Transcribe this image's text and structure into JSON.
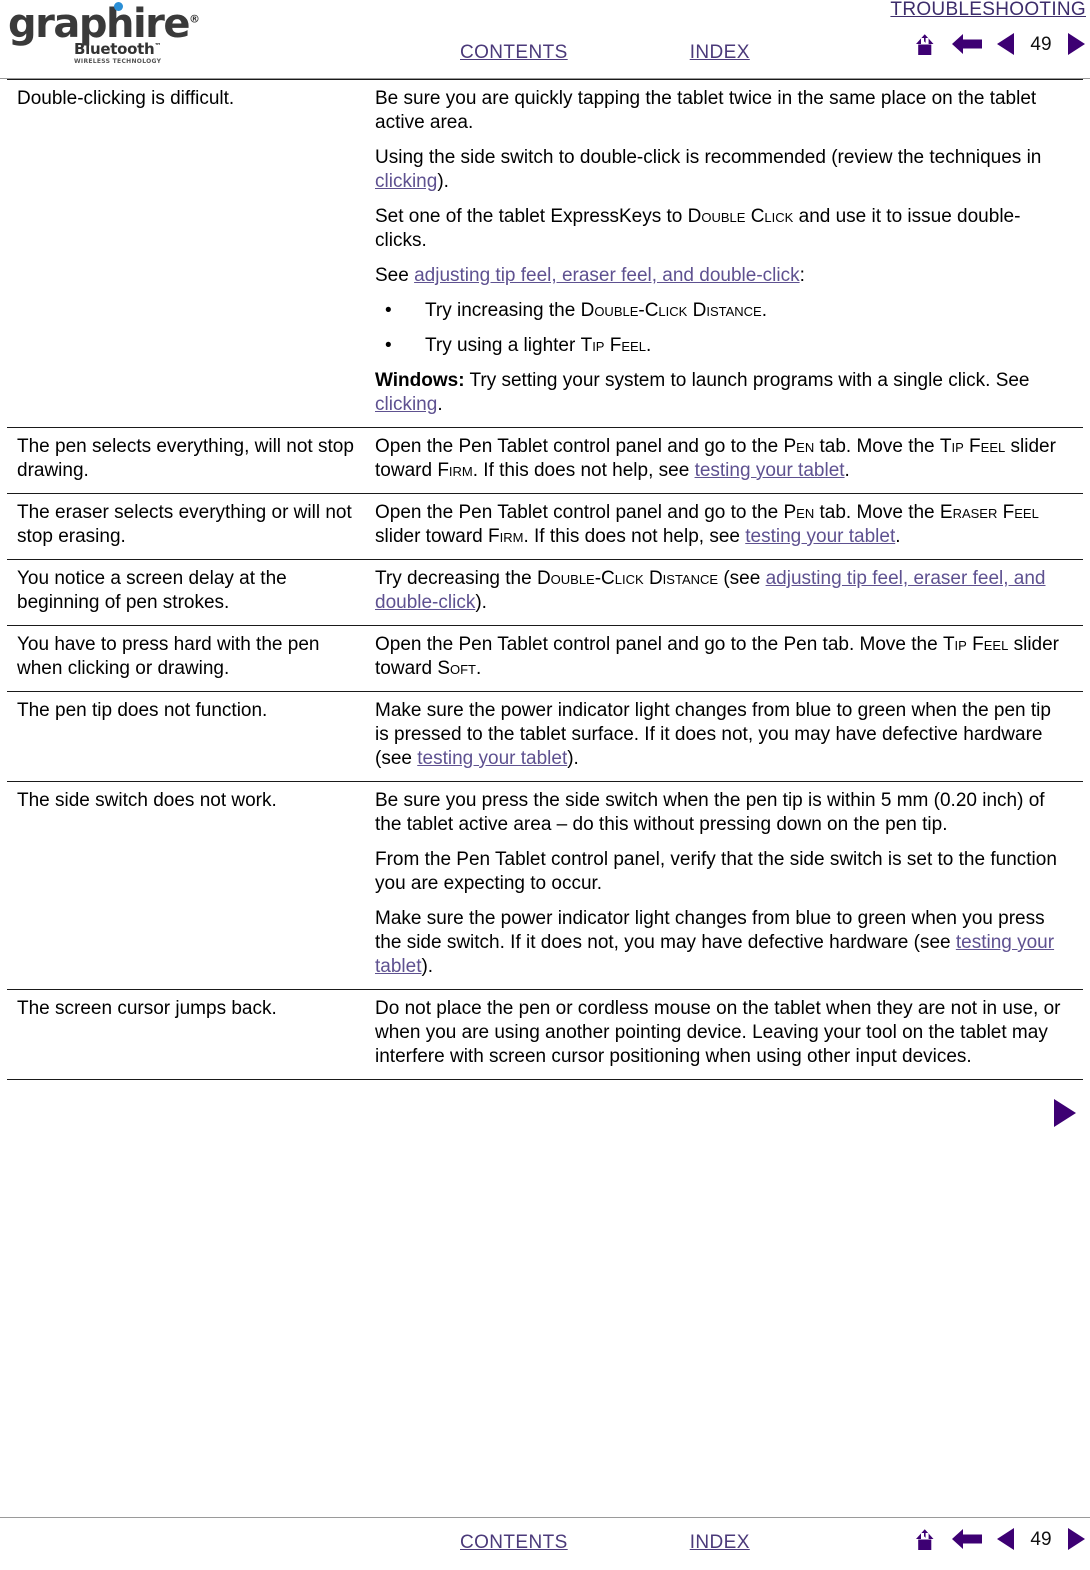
{
  "brand": {
    "name": "graphire",
    "registered": "®",
    "bluetooth": "Bluetooth",
    "bluetooth_tm": "™",
    "tagline": "WIRELESS TECHNOLOGY",
    "dot_color": "#2b8fd6"
  },
  "header": {
    "section_title": "TROUBLESHOOTING",
    "contents_label": "CONTENTS",
    "index_label": "INDEX",
    "page_number": "49",
    "nav_icons": [
      "home-icon",
      "back-arrow-icon",
      "previous-page-icon",
      "next-page-icon"
    ],
    "accent_color": "#3d0073",
    "link_color": "#5e5190"
  },
  "footer": {
    "contents_label": "CONTENTS",
    "index_label": "INDEX",
    "page_number": "49"
  },
  "content": {
    "next_arrow": "next-page-icon",
    "rows": [
      {
        "problem": "Double-clicking is difficult.",
        "solution": [
          {
            "type": "para",
            "runs": [
              {
                "t": "Be sure you are quickly tapping the tablet twice in the same place on the tablet active area.",
                "s": "plain"
              }
            ]
          },
          {
            "type": "para",
            "runs": [
              {
                "t": "Using the side switch to double-click is recommended (review the techniques in ",
                "s": "plain"
              },
              {
                "t": "clicking",
                "s": "link"
              },
              {
                "t": ").",
                "s": "plain"
              }
            ]
          },
          {
            "type": "para",
            "runs": [
              {
                "t": "Set one of the tablet ExpressKeys to ",
                "s": "plain"
              },
              {
                "t": "Double Click",
                "s": "smallcaps"
              },
              {
                "t": " and use it to issue double-clicks.",
                "s": "plain"
              }
            ]
          },
          {
            "type": "para",
            "runs": [
              {
                "t": "See ",
                "s": "plain"
              },
              {
                "t": "adjusting tip feel, eraser feel, and double-click",
                "s": "link"
              },
              {
                "t": ":",
                "s": "plain"
              }
            ]
          },
          {
            "type": "bullet",
            "runs": [
              {
                "t": "Try increasing the ",
                "s": "plain"
              },
              {
                "t": "Double-Click Distance",
                "s": "smallcaps"
              },
              {
                "t": ".",
                "s": "plain"
              }
            ]
          },
          {
            "type": "bullet",
            "runs": [
              {
                "t": "Try using a lighter ",
                "s": "plain"
              },
              {
                "t": "Tip Feel",
                "s": "smallcaps"
              },
              {
                "t": ".",
                "s": "plain"
              }
            ]
          },
          {
            "type": "para",
            "runs": [
              {
                "t": "Windows:",
                "s": "bold"
              },
              {
                "t": " Try setting your system to launch programs with a single click.  See ",
                "s": "plain"
              },
              {
                "t": "clicking",
                "s": "link"
              },
              {
                "t": ".",
                "s": "plain"
              }
            ]
          }
        ]
      },
      {
        "problem": "The pen selects everything, will not stop drawing.",
        "solution": [
          {
            "type": "para",
            "runs": [
              {
                "t": "Open the Pen Tablet control panel and go to the ",
                "s": "plain"
              },
              {
                "t": "Pen",
                "s": "smallcaps"
              },
              {
                "t": " tab.  Move the ",
                "s": "plain"
              },
              {
                "t": "Tip Feel",
                "s": "smallcaps"
              },
              {
                "t": " slider toward ",
                "s": "plain"
              },
              {
                "t": "Firm",
                "s": "smallcaps"
              },
              {
                "t": ".  If this does not help, see ",
                "s": "plain"
              },
              {
                "t": "testing your tablet",
                "s": "link"
              },
              {
                "t": ".",
                "s": "plain"
              }
            ]
          }
        ]
      },
      {
        "problem": "The eraser selects everything or will not stop erasing.",
        "solution": [
          {
            "type": "para",
            "runs": [
              {
                "t": "Open the Pen Tablet control panel and go to the ",
                "s": "plain"
              },
              {
                "t": "Pen",
                "s": "smallcaps"
              },
              {
                "t": " tab.  Move the ",
                "s": "plain"
              },
              {
                "t": "Eraser Feel",
                "s": "smallcaps"
              },
              {
                "t": " slider toward ",
                "s": "plain"
              },
              {
                "t": "Firm",
                "s": "smallcaps"
              },
              {
                "t": ".  If this does not help, see ",
                "s": "plain"
              },
              {
                "t": "testing your tablet",
                "s": "link"
              },
              {
                "t": ".",
                "s": "plain"
              }
            ]
          }
        ]
      },
      {
        "problem": "You notice a screen delay at the beginning of pen strokes.",
        "solution": [
          {
            "type": "para",
            "runs": [
              {
                "t": "Try decreasing the ",
                "s": "plain"
              },
              {
                "t": "Double-Click Distance",
                "s": "smallcaps"
              },
              {
                "t": " (see ",
                "s": "plain"
              },
              {
                "t": "adjusting tip feel, eraser feel, and double-click",
                "s": "link"
              },
              {
                "t": ").",
                "s": "plain"
              }
            ]
          }
        ]
      },
      {
        "problem": "You have to press hard with the pen when clicking or drawing.",
        "solution": [
          {
            "type": "para",
            "runs": [
              {
                "t": "Open the Pen Tablet control panel and go to the Pen tab.  Move the ",
                "s": "plain"
              },
              {
                "t": "Tip Feel",
                "s": "smallcaps"
              },
              {
                "t": " slider toward ",
                "s": "plain"
              },
              {
                "t": "Soft",
                "s": "smallcaps"
              },
              {
                "t": ".",
                "s": "plain"
              }
            ]
          }
        ]
      },
      {
        "problem": "The pen tip does not function.",
        "solution": [
          {
            "type": "para",
            "runs": [
              {
                "t": "Make sure the power indicator light changes from blue to green when the pen tip is pressed to the tablet surface.  If it does not, you may have defective hardware (see ",
                "s": "plain"
              },
              {
                "t": "testing your tablet",
                "s": "link"
              },
              {
                "t": ").",
                "s": "plain"
              }
            ]
          }
        ]
      },
      {
        "problem": "The side switch does not work.",
        "solution": [
          {
            "type": "para",
            "runs": [
              {
                "t": "Be sure you press the side switch when the pen tip is within 5 mm (0.20 inch) of the tablet active area – do this without pressing down on the pen tip.",
                "s": "plain"
              }
            ]
          },
          {
            "type": "para",
            "runs": [
              {
                "t": "From the Pen Tablet control panel, verify that the side switch is set to the function you are expecting to occur.",
                "s": "plain"
              }
            ]
          },
          {
            "type": "para",
            "runs": [
              {
                "t": "Make sure the power indicator light changes from blue to green when you press the side switch.  If it does not, you may have defective hardware (see ",
                "s": "plain"
              },
              {
                "t": "testing your tablet",
                "s": "link"
              },
              {
                "t": ").",
                "s": "plain"
              }
            ]
          }
        ]
      },
      {
        "problem": "The screen cursor jumps back.",
        "solution": [
          {
            "type": "para",
            "runs": [
              {
                "t": "Do not place the pen or cordless mouse on the tablet when they are not in use, or when you are using another pointing device.  Leaving your tool on the tablet may interfere with screen cursor positioning when using other input devices.",
                "s": "plain"
              }
            ]
          }
        ]
      }
    ]
  }
}
